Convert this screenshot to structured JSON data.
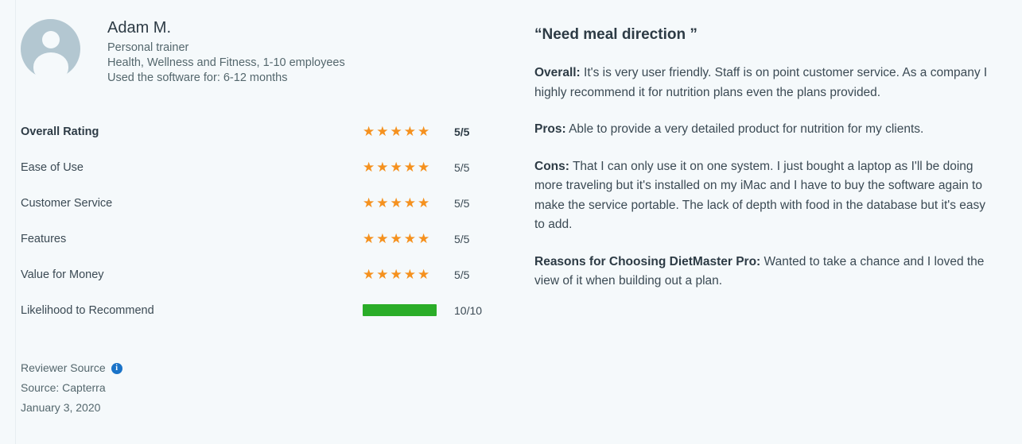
{
  "reviewer": {
    "avatar_icon": "user-avatar-icon",
    "name": "Adam M.",
    "job_title": "Personal trainer",
    "industry": "Health, Wellness and Fitness, 1-10 employees",
    "usage": "Used the software for: 6-12 months"
  },
  "ratings": [
    {
      "label": "Overall Rating",
      "type": "stars",
      "stars": 5,
      "max": 5,
      "score": "5/5",
      "primary": true
    },
    {
      "label": "Ease of Use",
      "type": "stars",
      "stars": 5,
      "max": 5,
      "score": "5/5",
      "primary": false
    },
    {
      "label": "Customer Service",
      "type": "stars",
      "stars": 5,
      "max": 5,
      "score": "5/5",
      "primary": false
    },
    {
      "label": "Features",
      "type": "stars",
      "stars": 5,
      "max": 5,
      "score": "5/5",
      "primary": false
    },
    {
      "label": "Value for Money",
      "type": "stars",
      "stars": 5,
      "max": 5,
      "score": "5/5",
      "primary": false
    },
    {
      "label": "Likelihood to Recommend",
      "type": "bar",
      "value": 10,
      "max": 10,
      "score": "10/10",
      "primary": false
    }
  ],
  "footer": {
    "reviewer_source_label": "Reviewer Source",
    "info_icon": "info-icon",
    "info_glyph": "i",
    "source": "Source: Capterra",
    "date": "January 3, 2020"
  },
  "review": {
    "title": "“Need meal direction ”",
    "sections": [
      {
        "heading": "Overall:",
        "body": " It's is very user friendly. Staff is on point customer service. As a company I highly recommend it for nutrition plans even the plans provided."
      },
      {
        "heading": "Pros:",
        "body": " Able to provide a very detailed product for nutrition for my clients."
      },
      {
        "heading": "Cons:",
        "body": " That I can only use it on one system. I just bought a laptop as I'll be doing more traveling but it's installed on my iMac and I have to buy the software again to make the service portable. The lack of depth with food in the database but it's easy to add."
      },
      {
        "heading": "Reasons for Choosing DietMaster Pro:",
        "body": " Wanted to take a chance and I loved the view of it when building out a plan."
      }
    ]
  },
  "colors": {
    "background": "#f5f9fb",
    "star": "#f5911e",
    "bar": "#2aad28",
    "info": "#1a73c8",
    "avatar": "#b3c7d1",
    "heading_text": "#2d3b45",
    "body_text": "#3b4a54",
    "muted_text": "#54676d"
  }
}
